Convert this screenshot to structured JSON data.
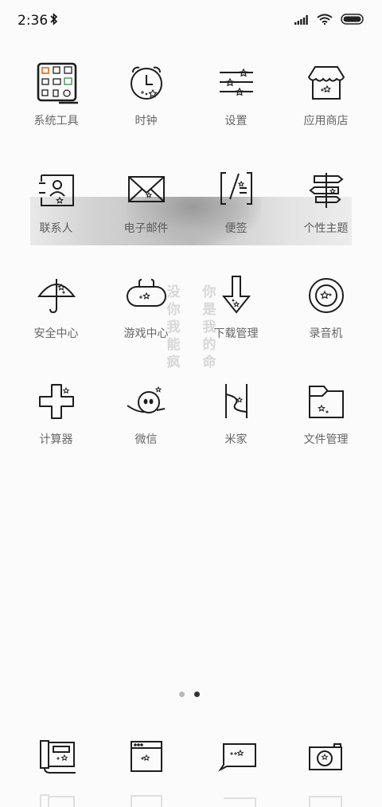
{
  "status_bar": {
    "time": "2:36",
    "bluetooth_icon": "bluetooth-icon",
    "signal_icon": "signal-icon",
    "wifi_icon": "wifi-icon",
    "battery_icon": "battery-icon"
  },
  "apps": [
    {
      "label": "系统工具",
      "icon": "toolbox-icon"
    },
    {
      "label": "时钟",
      "icon": "clock-icon"
    },
    {
      "label": "设置",
      "icon": "settings-sliders-icon"
    },
    {
      "label": "应用商店",
      "icon": "store-icon"
    },
    {
      "label": "联系人",
      "icon": "contacts-icon"
    },
    {
      "label": "电子邮件",
      "icon": "mail-icon"
    },
    {
      "label": "便签",
      "icon": "notes-icon"
    },
    {
      "label": "个性主题",
      "icon": "signpost-icon"
    },
    {
      "label": "安全中心",
      "icon": "umbrella-icon"
    },
    {
      "label": "游戏中心",
      "icon": "gamepad-icon"
    },
    {
      "label": "下载管理",
      "icon": "download-arrow-icon"
    },
    {
      "label": "录音机",
      "icon": "recorder-icon"
    },
    {
      "label": "计算器",
      "icon": "calculator-icon"
    },
    {
      "label": "微信",
      "icon": "wechat-icon"
    },
    {
      "label": "米家",
      "icon": "mijia-icon"
    },
    {
      "label": "文件管理",
      "icon": "folder-icon"
    }
  ],
  "wallpaper_text": {
    "column1": "没你我能疯",
    "column2": "你是我的命"
  },
  "page_indicator": {
    "total": 2,
    "active": 2
  },
  "dock": [
    {
      "icon": "phone-icon"
    },
    {
      "icon": "browser-icon"
    },
    {
      "icon": "messages-icon"
    },
    {
      "icon": "camera-icon"
    }
  ],
  "colors": {
    "background": "#fbfbfb",
    "icon_stroke": "#1e1e1e",
    "label": "#666666"
  }
}
